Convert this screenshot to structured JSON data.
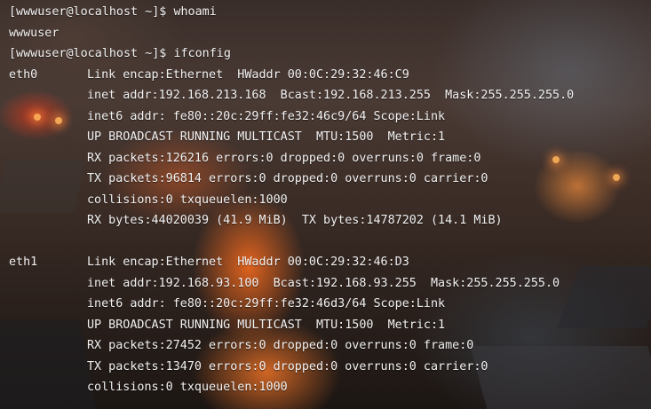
{
  "terminal": {
    "lines": [
      {
        "prompt": "[wwwuser@localhost ~]$ ",
        "command": "whoami"
      },
      {
        "output": "wwwuser"
      },
      {
        "prompt": "[wwwuser@localhost ~]$ ",
        "command": "ifconfig"
      }
    ],
    "interfaces": [
      {
        "name": "eth0",
        "details": [
          "Link encap:Ethernet  HWaddr 00:0C:29:32:46:C9",
          "inet addr:192.168.213.168  Bcast:192.168.213.255  Mask:255.255.255.0",
          "inet6 addr: fe80::20c:29ff:fe32:46c9/64 Scope:Link",
          "UP BROADCAST RUNNING MULTICAST  MTU:1500  Metric:1",
          "RX packets:126216 errors:0 dropped:0 overruns:0 frame:0",
          "TX packets:96814 errors:0 dropped:0 overruns:0 carrier:0",
          "collisions:0 txqueuelen:1000",
          "RX bytes:44020039 (41.9 MiB)  TX bytes:14787202 (14.1 MiB)"
        ]
      },
      {
        "name": "eth1",
        "details": [
          "Link encap:Ethernet  HWaddr 00:0C:29:32:46:D3",
          "inet addr:192.168.93.100  Bcast:192.168.93.255  Mask:255.255.255.0",
          "inet6 addr: fe80::20c:29ff:fe32:46d3/64 Scope:Link",
          "UP BROADCAST RUNNING MULTICAST  MTU:1500  Metric:1",
          "RX packets:27452 errors:0 dropped:0 overruns:0 frame:0",
          "TX packets:13470 errors:0 dropped:0 overruns:0 carrier:0",
          "collisions:0 txqueuelen:1000"
        ]
      }
    ]
  },
  "colors": {
    "text": "#f2f2f2",
    "background": "#241a16"
  }
}
